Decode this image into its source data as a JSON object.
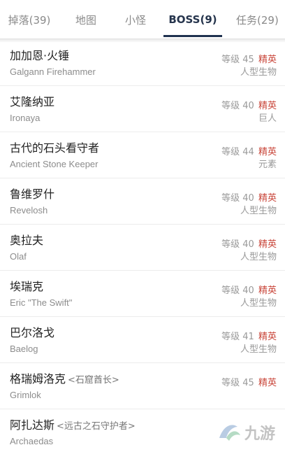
{
  "tabs": [
    {
      "label": "掉落(39)"
    },
    {
      "label": "地图"
    },
    {
      "label": "小怪"
    },
    {
      "label": "BOSS(9)"
    },
    {
      "label": "任务(29)"
    }
  ],
  "active_tab": "BOSS(9)",
  "bosses": [
    {
      "name": "加加恩·火锤",
      "name_en": "Galgann Firehammer",
      "level_text": "等级 45",
      "rank": "精英",
      "type": "人型生物"
    },
    {
      "name": "艾隆纳亚",
      "name_en": "Ironaya",
      "level_text": "等级 40",
      "rank": "精英",
      "type": "巨人"
    },
    {
      "name": "古代的石头看守者",
      "name_en": "Ancient Stone Keeper",
      "level_text": "等级 44",
      "rank": "精英",
      "type": "元素"
    },
    {
      "name": "鲁维罗什",
      "name_en": "Revelosh",
      "level_text": "等级 40",
      "rank": "精英",
      "type": "人型生物"
    },
    {
      "name": "奥拉夫",
      "name_en": "Olaf",
      "level_text": "等级 40",
      "rank": "精英",
      "type": "人型生物"
    },
    {
      "name": "埃瑞克",
      "name_en": "Eric \"The Swift\"",
      "level_text": "等级 40",
      "rank": "精英",
      "type": "人型生物"
    },
    {
      "name": "巴尔洛戈",
      "name_en": "Baelog",
      "level_text": "等级 41",
      "rank": "精英",
      "type": "人型生物"
    },
    {
      "name": "格瑞姆洛克",
      "name_sub": "<石窟酋长>",
      "name_en": "Grimlok",
      "level_text": "等级 45",
      "rank": "精英",
      "type": ""
    },
    {
      "name": "阿扎达斯",
      "name_sub": "<远古之石守护者>",
      "name_en": "Archaedas",
      "level_text": "",
      "rank": "",
      "type": ""
    }
  ],
  "watermark": {
    "icon": "jiuyou-logo-icon",
    "text": "九游"
  },
  "colors": {
    "active_tab": "#26354d",
    "elite": "#c9473b",
    "underline": "#1f3250"
  }
}
